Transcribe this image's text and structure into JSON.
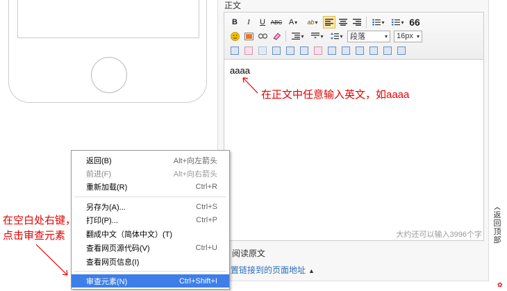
{
  "editor": {
    "section_label": "正文",
    "content": "aaaa",
    "paragraph_select": "段落",
    "font_size_select": "16px",
    "word_count": "大约还可以输入3996个字",
    "read_original": "阅读原文",
    "link_setting": "设置链接到的页面地址"
  },
  "toolbar_row1": [
    "B",
    "I",
    "U",
    "ABC",
    "A",
    "ab",
    "align-left",
    "align-center",
    "align-right",
    "unordered-list",
    "ordered-list",
    "66"
  ],
  "annotations": {
    "right": "在正文中任意输入英文，如aaaa",
    "left_line1": "在空白处右键，",
    "left_line2": "点击审查元素"
  },
  "back_to_top": [
    "返",
    "回",
    "顶",
    "部"
  ],
  "context_menu": {
    "items": [
      {
        "label": "返回(B)",
        "shortcut": "Alt+向左箭头",
        "disabled": false
      },
      {
        "label": "前进(F)",
        "shortcut": "Alt+向右箭头",
        "disabled": true
      },
      {
        "label": "重新加载(R)",
        "shortcut": "Ctrl+R",
        "disabled": false
      },
      {
        "label": "另存为(A)...",
        "shortcut": "Ctrl+S",
        "disabled": false
      },
      {
        "label": "打印(P)...",
        "shortcut": "Ctrl+P",
        "disabled": false
      },
      {
        "label": "翻成中文（简体中文）(T)",
        "shortcut": "",
        "disabled": false
      },
      {
        "label": "查看网页源代码(V)",
        "shortcut": "Ctrl+U",
        "disabled": false
      },
      {
        "label": "查看网页信息(I)",
        "shortcut": "",
        "disabled": false
      },
      {
        "label": "审查元素(N)",
        "shortcut": "Ctrl+Shift+I",
        "disabled": false
      }
    ]
  },
  "colors": {
    "annotation": "#e60000",
    "menu_highlight": "#3d7ee9",
    "link": "#2a6ebb"
  }
}
